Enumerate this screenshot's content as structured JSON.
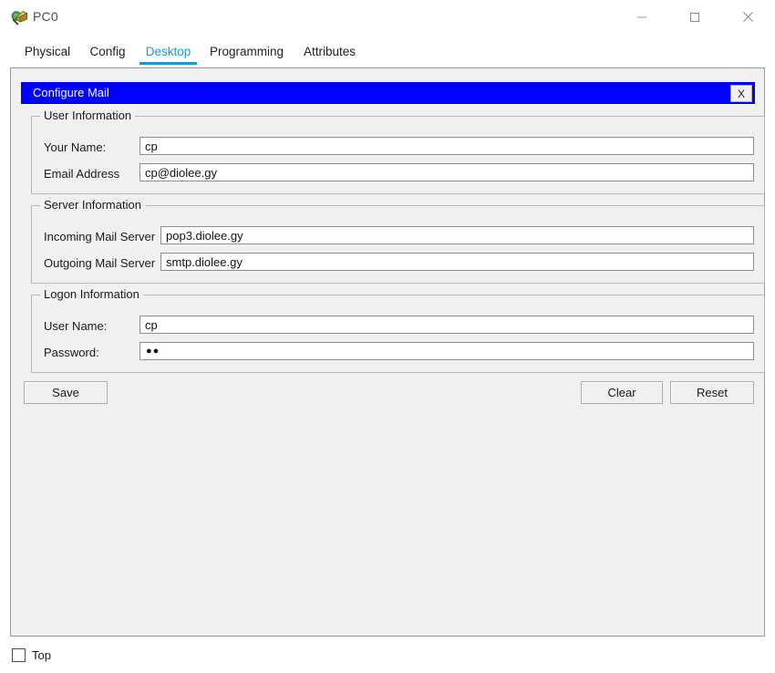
{
  "window": {
    "title": "PC0",
    "icon": "pc-device-icon",
    "controls": {
      "minimize": "minimize-icon",
      "maximize": "maximize-icon",
      "close": "close-icon"
    }
  },
  "tabs": [
    {
      "label": "Physical",
      "active": false
    },
    {
      "label": "Config",
      "active": false
    },
    {
      "label": "Desktop",
      "active": true
    },
    {
      "label": "Programming",
      "active": false
    },
    {
      "label": "Attributes",
      "active": false
    }
  ],
  "app": {
    "header_title": "Configure Mail",
    "close_label": "X",
    "header_bg": "#0000ff",
    "accent": "#1b9bc9"
  },
  "groups": {
    "user": {
      "legend": "User Information",
      "fields": [
        {
          "label": "Your Name:",
          "value": "cp"
        },
        {
          "label": "Email Address",
          "value": "cp@diolee.gy"
        }
      ]
    },
    "server": {
      "legend": "Server Information",
      "fields": [
        {
          "label": "Incoming Mail Server",
          "value": "pop3.diolee.gy"
        },
        {
          "label": "Outgoing Mail Server",
          "value": "smtp.diolee.gy"
        }
      ]
    },
    "logon": {
      "legend": "Logon Information",
      "fields": [
        {
          "label": "User Name:",
          "value": "cp"
        },
        {
          "label": "Password:",
          "value": "●●"
        }
      ]
    }
  },
  "buttons": {
    "save": "Save",
    "clear": "Clear",
    "reset": "Reset"
  },
  "footer": {
    "top_checkbox_label": "Top",
    "top_checkbox_checked": false
  }
}
